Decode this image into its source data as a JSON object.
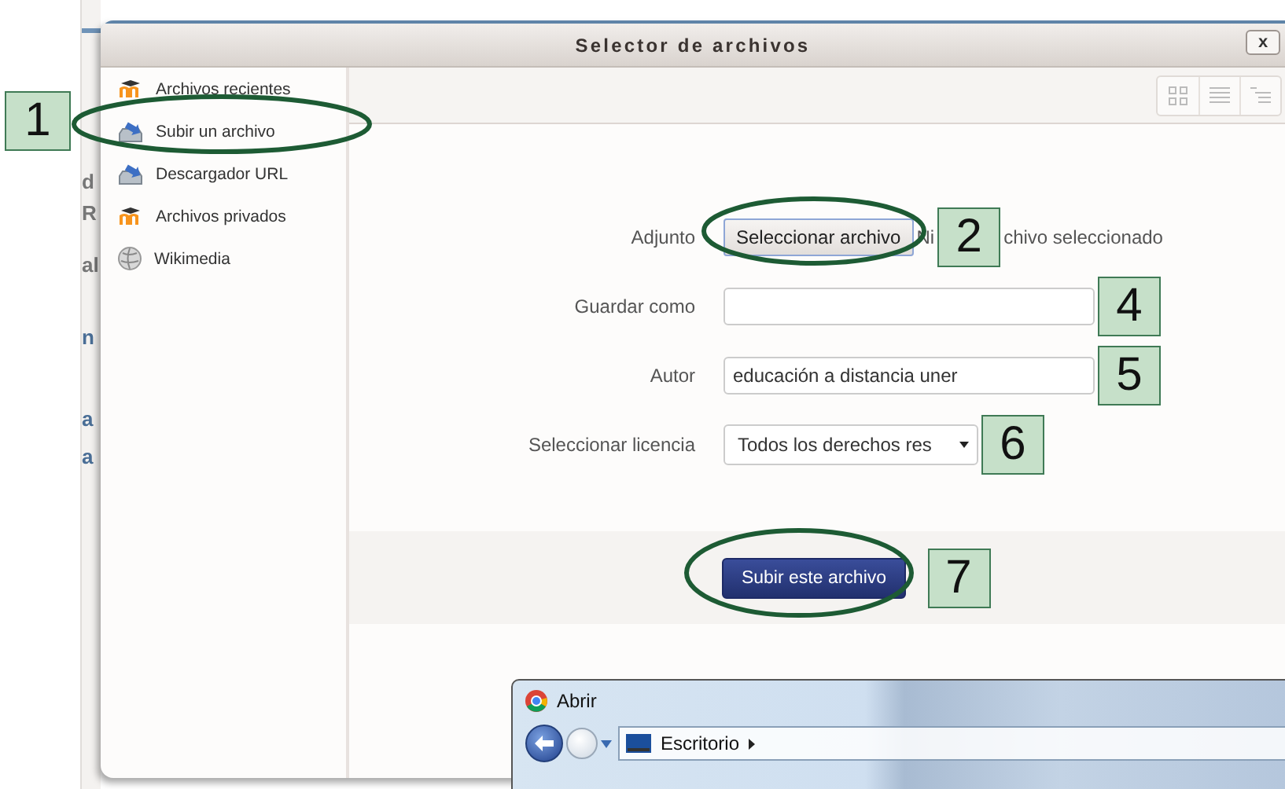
{
  "background_page": {
    "fragments": [
      "d",
      "R",
      "al",
      "n",
      "a",
      "a"
    ]
  },
  "dialog": {
    "title": "Selector de archivos",
    "close": "x"
  },
  "sidebar": {
    "callout": "1",
    "items": [
      {
        "label": "Archivos recientes",
        "kind": "moodle"
      },
      {
        "label": "Subir un archivo",
        "kind": "upload"
      },
      {
        "label": "Descargador URL",
        "kind": "upload"
      },
      {
        "label": "Archivos privados",
        "kind": "moodle"
      },
      {
        "label": "Wikimedia",
        "kind": "globe"
      }
    ]
  },
  "form": {
    "rows": [
      {
        "kind": "file",
        "label": "Adjunto",
        "button": "Seleccionar archivo",
        "status_start": "Ni",
        "status_end": "chivo seleccionado",
        "callout": "2"
      },
      {
        "kind": "text",
        "label": "Guardar como",
        "callout": "4"
      },
      {
        "kind": "text",
        "label": "Autor",
        "value": "educación a distancia uner",
        "callout": "5"
      },
      {
        "kind": "select",
        "label": "Seleccionar licencia",
        "value": "Todos los derechos res",
        "callout": "6"
      }
    ]
  },
  "submit": {
    "label": "Subir este archivo",
    "callout": "7"
  },
  "open_dialog": {
    "title": "Abrir",
    "path": "Escritorio"
  }
}
